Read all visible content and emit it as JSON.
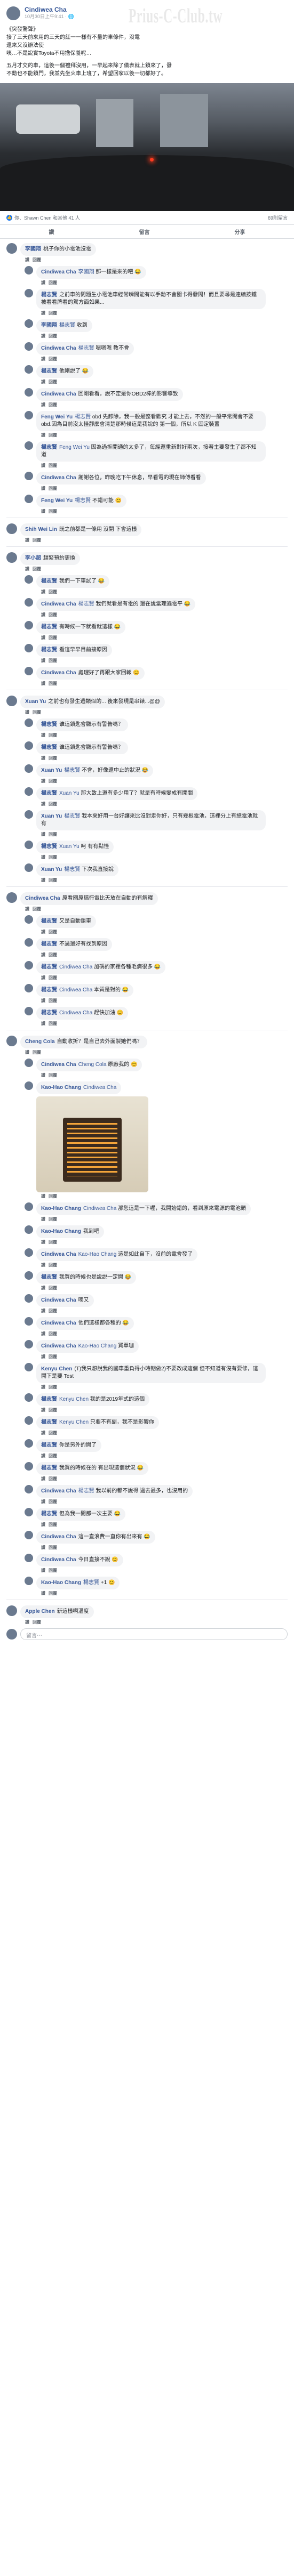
{
  "watermark": "Prius-C-Club.tw",
  "post": {
    "author": "Cindiwea Cha",
    "time": "10月30日上午9:41 · 🌐",
    "lines": [
      "《突發驚聲》",
      "接了三天前來用的三天的紅一一樣有不量的車條件，沒電",
      "還來又沒辦法使",
      "咦…不是說實Toyota不用擔保養呢…",
      "",
      "五月才交的車，這後一個禮拜沒用，一早起來除了儀表就上鎖來了，發",
      "不動也不能鎖門，我並先坐火車上班了，希望回家以後一切都好了。"
    ],
    "reactions_text": "你、Shawn Chen 和其他 41 人",
    "comment_count": "69則留言",
    "like_label": "讚",
    "comment_label": "留言",
    "share_label": "分享"
  },
  "comments": [
    {
      "name": "李國翔",
      "tag": "",
      "text": "桃子你的小電池沒電",
      "reply": false
    },
    {
      "name": "Cindiwea Cha",
      "tag": "李國翔",
      "text": "那一樣是來的吧 😂",
      "reply": true
    },
    {
      "name": "楊志賢",
      "tag": "",
      "text": "之前車的問題生小電池車經常瞬間能有以手動不會關卡得發問！而且要尋是連續按鐵被看看牌看的駕方面如果...",
      "reply": true
    },
    {
      "name": "李國翔",
      "tag": "楊志賢",
      "text": "收到",
      "reply": true
    },
    {
      "name": "Cindiwea Cha",
      "tag": "楊志賢",
      "text": "嗯嗯嗯 教不會",
      "reply": true
    },
    {
      "name": "楊志賢",
      "tag": "",
      "text": "他剛說了 😂",
      "reply": true
    },
    {
      "name": "Cindiwea Cha",
      "tag": "",
      "text": "回剛看看，說不定是你OBD2棒的影響導致",
      "reply": true
    },
    {
      "name": "Feng Wei Yu",
      "tag": "楊志賢",
      "text": "obd 先卸除，我一般是整看歡究 才能上去，不然的一般平常開會不要obd.因為目前沒太怪靜麼會清楚那時候這是我說的 第一個，所以 K 固定裝置",
      "reply": true
    },
    {
      "name": "楊志賢",
      "tag": "Feng Wei Yu",
      "text": "因為過拆開通的太多了，每經還重新對好兩次，接著主要發生了都不知道",
      "reply": true
    },
    {
      "name": "Cindiwea Cha",
      "tag": "",
      "text": "謝謝各位，昨晚吃下午休息，早看電的現在師傅看看",
      "reply": true
    },
    {
      "name": "Feng Wei Yu",
      "tag": "楊志賢",
      "text": "不錯可能 😊",
      "reply": true
    },
    {
      "name": "Shih Wei Lin",
      "tag": "",
      "text": "既之前都是一條用 沒開 下會這樣",
      "reply": false
    },
    {
      "name": "李小超",
      "tag": "",
      "text": "趕緊預約更換",
      "reply": false
    },
    {
      "name": "楊志賢",
      "tag": "",
      "text": "我們一下車試了 😂",
      "reply": true
    },
    {
      "name": "Cindiwea Cha",
      "tag": "楊志賢",
      "text": "我們就看是有電的 還在說當理遍電平 😂",
      "reply": true
    },
    {
      "name": "楊志賢",
      "tag": "",
      "text": "有時候一下就看就這樣 😂",
      "reply": true
    },
    {
      "name": "楊志賢",
      "tag": "",
      "text": "看這早早目前接原因",
      "reply": true
    },
    {
      "name": "Cindiwea Cha",
      "tag": "",
      "text": "處理好了再跟大家回報 😊",
      "reply": true
    },
    {
      "name": "Xuan Yu",
      "tag": "",
      "text": "之前也有發生過類似的... 後來發現是串錶...@@",
      "reply": false
    },
    {
      "name": "楊志賢",
      "tag": "",
      "text": "谁這鎖匙會顯示有警告嗎？",
      "reply": true
    },
    {
      "name": "楊志賢",
      "tag": "",
      "text": "谁這鎖匙會顯示有警告嗎？",
      "reply": true
    },
    {
      "name": "Xuan Yu",
      "tag": "楊志賢",
      "text": "不會，好像還中止的狀況 😂",
      "reply": true
    },
    {
      "name": "楊志賢",
      "tag": "Xuan Yu",
      "text": "那大致上還有多少用了？就是有時候變成有開關",
      "reply": true
    },
    {
      "name": "Xuan Yu",
      "tag": "楊志賢",
      "text": "我本來好用一台好讓來比沒對走你好，只有幾根電池，這裡分上有總電池就有",
      "reply": true
    },
    {
      "name": "楊志賢",
      "tag": "Xuan Yu",
      "text": "呵 有有點怪",
      "reply": true
    },
    {
      "name": "Xuan Yu",
      "tag": "楊志賢",
      "text": "下次我直接說",
      "reply": true
    },
    {
      "name": "Cindiwea Cha",
      "tag": "",
      "text": "原看國原稿行電比天放在自動的有解釋",
      "reply": false
    },
    {
      "name": "楊志賢",
      "tag": "",
      "text": "又是自動鎖車",
      "reply": true
    },
    {
      "name": "楊志賢",
      "tag": "",
      "text": "不過還好有找到原因",
      "reply": true
    },
    {
      "name": "楊志賢",
      "tag": "Cindiwea Cha",
      "text": "加碼的家裡各種毛病很多 😂",
      "reply": true
    },
    {
      "name": "楊志賢",
      "tag": "Cindiwea Cha",
      "text": "本質是對的 😂",
      "reply": true
    },
    {
      "name": "楊志賢",
      "tag": "Cindiwea Cha",
      "text": "趕快加油 😊",
      "reply": true
    },
    {
      "name": "Cheng Cola",
      "tag": "",
      "text": "自動收折？是自己去外面製她們嗎？",
      "reply": false
    },
    {
      "name": "Cindiwea Cha",
      "tag": "Cheng Cola",
      "text": "原廠我的 😊",
      "reply": true
    },
    {
      "name": "Kao-Hao Chang",
      "tag": "Cindiwea Cha",
      "text": "",
      "reply": true,
      "image": true
    },
    {
      "name": "Kao-Hao Chang",
      "tag": "Cindiwea Cha",
      "text": "那您這是一下喔，我開始錯的，看到原來電源的電池頭",
      "reply": true
    },
    {
      "name": "Kao-Hao Chang",
      "tag": "",
      "text": "我到吧",
      "reply": true
    },
    {
      "name": "Cindiwea Cha",
      "tag": "Kao-Hao Chang",
      "text": "這是如此自下，沒前的電會發了",
      "reply": true
    },
    {
      "name": "楊志賢",
      "tag": "",
      "text": "我買的時候也是說說一定開 😂",
      "reply": true
    },
    {
      "name": "Cindiwea Cha",
      "tag": "",
      "text": "噢又",
      "reply": true
    },
    {
      "name": "Cindiwea Cha",
      "tag": "",
      "text": "他們這樣都各種的 😂",
      "reply": true
    },
    {
      "name": "Cindiwea Cha",
      "tag": "Kao-Hao Chang",
      "text": "買單咖",
      "reply": true
    },
    {
      "name": "Kenyu Chen",
      "tag": "",
      "text": "(T)我只想說我的國車重負得小時期做2)不要改成這個 但不知道有沒有要修，這開下是要 Test",
      "reply": true
    },
    {
      "name": "楊志賢",
      "tag": "Kenyu Chen",
      "text": "我的是2019年式的這個",
      "reply": true
    },
    {
      "name": "楊志賢",
      "tag": "Kenyu Chen",
      "text": "只要不有副，我不是影響你",
      "reply": true
    },
    {
      "name": "楊志賢",
      "tag": "",
      "text": "你是另外的開了",
      "reply": true
    },
    {
      "name": "楊志賢",
      "tag": "",
      "text": "我買的時候在的 有出現這個狀況 😂",
      "reply": true
    },
    {
      "name": "Cindiwea Cha",
      "tag": "楊志賢",
      "text": "我以前的都不說得 過去最多，也沒用的",
      "reply": true
    },
    {
      "name": "楊志賢",
      "tag": "",
      "text": "但為我一開那一次主要 😂",
      "reply": true
    },
    {
      "name": "Cindiwea Cha",
      "tag": "",
      "text": "這一直浪費一直你有出來有 😂",
      "reply": true
    },
    {
      "name": "Cindiwea Cha",
      "tag": "",
      "text": "今日直接不說 😊",
      "reply": true
    },
    {
      "name": "Kao-Hao Chang",
      "tag": "楊志賢",
      "text": "+1 😊",
      "reply": true
    },
    {
      "name": "Apple Chen",
      "tag": "",
      "text": "新這樣啊溫度",
      "reply": false
    }
  ],
  "reply_toggle": "查看更多回覆",
  "actions": {
    "like": "讚",
    "reply": "回覆"
  },
  "write_placeholder": "留言⋯"
}
